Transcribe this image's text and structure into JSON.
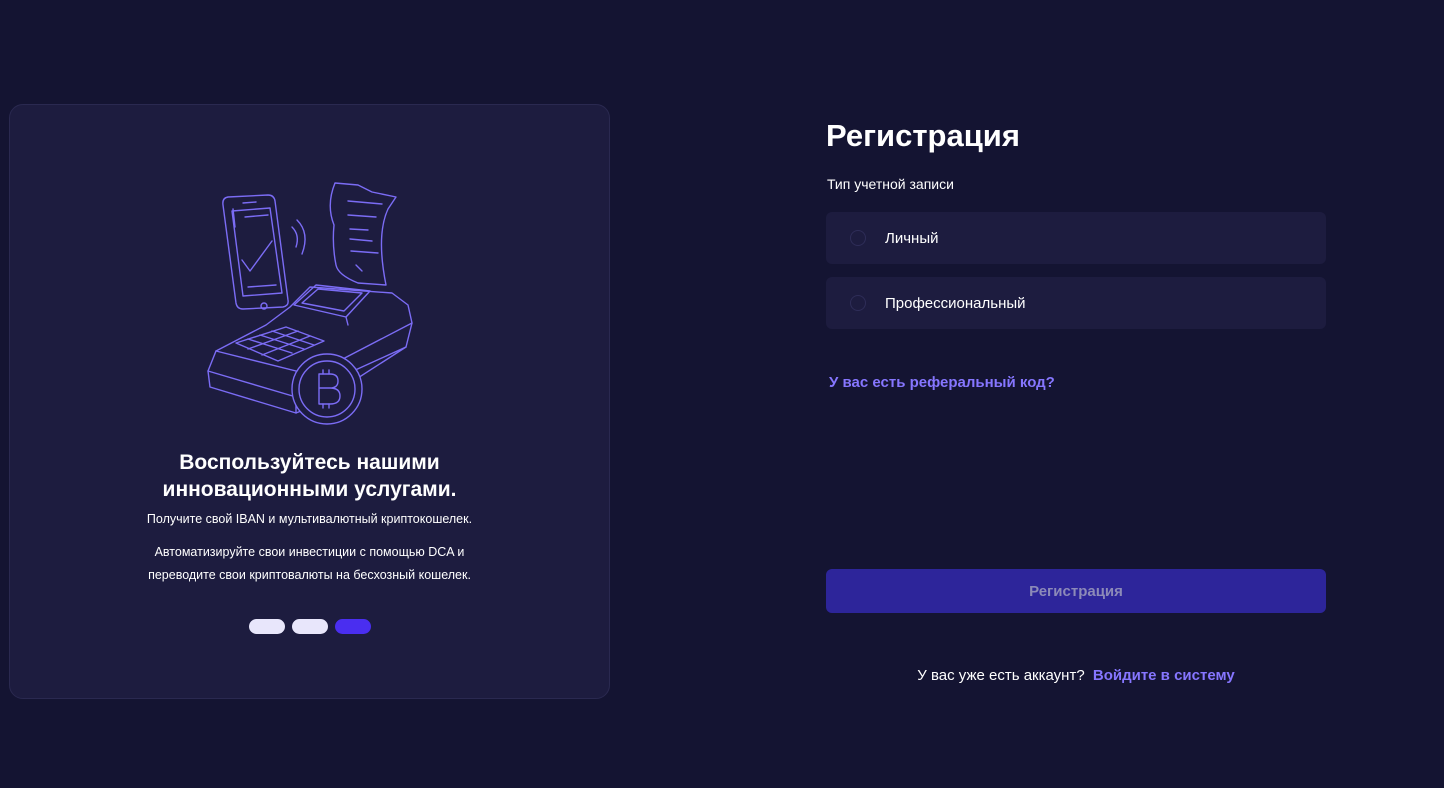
{
  "colors": {
    "background": "#141432",
    "card": "#1d1c3f",
    "accent": "#8676ff",
    "button": "#2d259a",
    "active_dot": "#4a2ef0"
  },
  "promo": {
    "illustration_icon": "payment-terminal-bitcoin-icon",
    "title_line1": "Воспользуйтесь нашими",
    "title_line2": "инновационными услугами.",
    "text1": "Получите свой IBAN и мультивалютный криптокошелек.",
    "text2_line1": "Автоматизируйте свои инвестиции с помощью DCA и",
    "text2_line2": "переводите свои криптовалюты на бесхозный кошелек.",
    "carousel": {
      "count": 3,
      "active_index": 2
    }
  },
  "form": {
    "title": "Регистрация",
    "account_type_label": "Тип учетной записи",
    "options": [
      {
        "label": "Личный",
        "selected": false
      },
      {
        "label": "Профессиональный",
        "selected": false
      }
    ],
    "referral_link": "У вас есть реферальный код?",
    "submit_label": "Регистрация",
    "login_prompt": "У вас уже есть аккаунт?",
    "login_link": "Войдите в систему"
  }
}
